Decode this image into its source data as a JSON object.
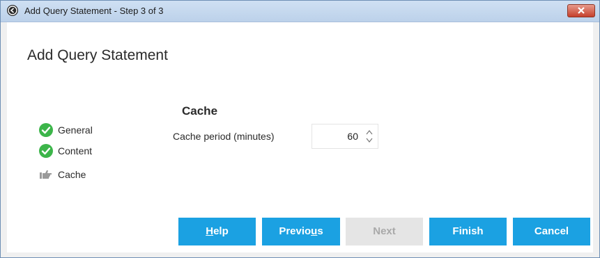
{
  "window": {
    "title": "Add Query Statement - Step 3 of 3"
  },
  "dialog": {
    "title": "Add Query Statement"
  },
  "steps": [
    {
      "label": "General",
      "status": "complete",
      "icon": "check-circle-icon"
    },
    {
      "label": "Content",
      "status": "complete",
      "icon": "check-circle-icon"
    },
    {
      "label": "Cache",
      "status": "current",
      "icon": "thumbs-up-pointer-icon"
    }
  ],
  "section": {
    "title": "Cache",
    "cache_period_label": "Cache period (minutes)",
    "cache_period_value": "60"
  },
  "buttons": {
    "help": {
      "label_mnemonic": "H",
      "label_rest": "elp"
    },
    "previous": {
      "label_start": "Previo",
      "label_mnemonic": "u",
      "label_rest": "s"
    },
    "next": {
      "label": "Next",
      "enabled": false
    },
    "finish": {
      "label": "Finish"
    },
    "cancel": {
      "label": "Cancel"
    }
  },
  "colors": {
    "accent": "#1ba1e2",
    "check": "#3cb54a",
    "disabled": "#e5e5e5"
  }
}
